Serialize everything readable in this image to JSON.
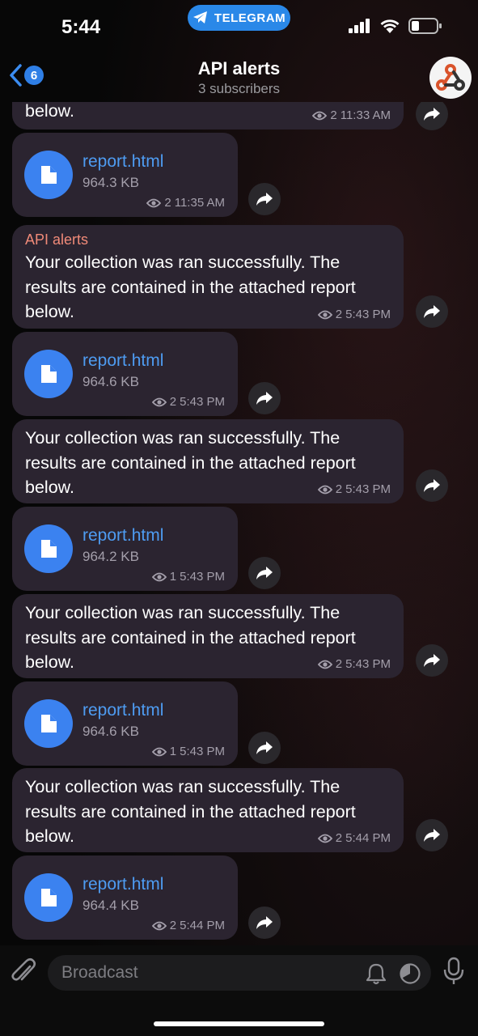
{
  "status_bar": {
    "time": "5:44",
    "app_pill_label": "TELEGRAM"
  },
  "header": {
    "back_badge": "6",
    "title": "API alerts",
    "subtitle": "3 subscribers",
    "avatar_icon": "webhook-icon"
  },
  "messages": [
    {
      "kind": "text",
      "sender": "",
      "body": "below.",
      "views": "2",
      "time": "11:33 AM"
    },
    {
      "kind": "file",
      "name": "report.html",
      "size": "964.3 KB",
      "views": "2",
      "time": "11:35 AM"
    },
    {
      "kind": "text",
      "sender": "API alerts",
      "body": "Your collection was ran successfully. The results are contained in the attached report below.",
      "views": "2",
      "time": "5:43 PM"
    },
    {
      "kind": "file",
      "name": "report.html",
      "size": "964.6 KB",
      "views": "2",
      "time": "5:43 PM"
    },
    {
      "kind": "text",
      "sender": "",
      "body": "Your collection was ran successfully. The results are contained in the attached report below.",
      "views": "2",
      "time": "5:43 PM"
    },
    {
      "kind": "file",
      "name": "report.html",
      "size": "964.2 KB",
      "views": "1",
      "time": "5:43 PM"
    },
    {
      "kind": "text",
      "sender": "",
      "body": "Your collection was ran successfully. The results are contained in the attached report below.",
      "views": "2",
      "time": "5:43 PM"
    },
    {
      "kind": "file",
      "name": "report.html",
      "size": "964.6 KB",
      "views": "1",
      "time": "5:43 PM"
    },
    {
      "kind": "text",
      "sender": "",
      "body": "Your collection was ran successfully. The results are contained in the attached report below.",
      "views": "2",
      "time": "5:44 PM"
    },
    {
      "kind": "file",
      "name": "report.html",
      "size": "964.4 KB",
      "views": "2",
      "time": "5:44 PM"
    }
  ],
  "input_bar": {
    "placeholder": "Broadcast"
  },
  "colors": {
    "accent": "#3b82f0",
    "link": "#4e9cf2",
    "bubble": "#2b2430",
    "sender": "#f08a78"
  }
}
